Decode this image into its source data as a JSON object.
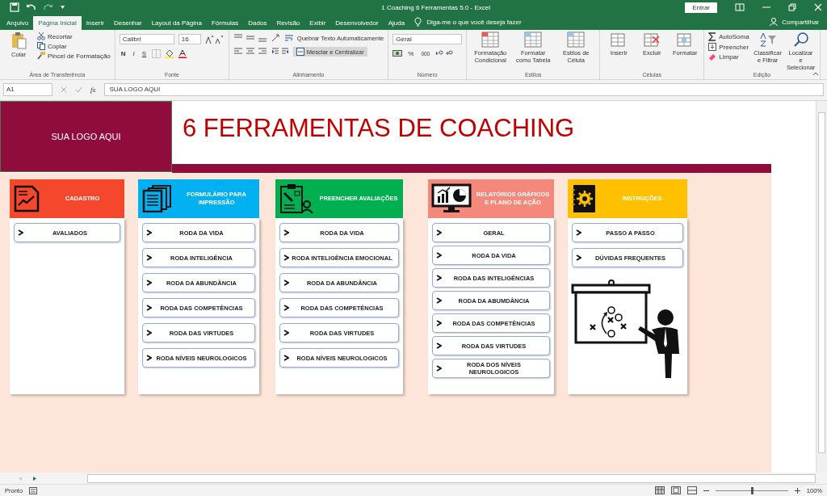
{
  "window": {
    "title": "1 Coaching 6 Ferramentas 5.0  -  Excel",
    "sign_in": "Entrar"
  },
  "ribbon_tabs": [
    {
      "label": "Arquivo",
      "selected": false
    },
    {
      "label": "Página Inicial",
      "selected": true
    },
    {
      "label": "Inserir",
      "selected": false
    },
    {
      "label": "Desenhar",
      "selected": false
    },
    {
      "label": "Layout da Página",
      "selected": false
    },
    {
      "label": "Fórmulas",
      "selected": false
    },
    {
      "label": "Dados",
      "selected": false
    },
    {
      "label": "Revisão",
      "selected": false
    },
    {
      "label": "Exibir",
      "selected": false
    },
    {
      "label": "Desenvolvedor",
      "selected": false
    },
    {
      "label": "Ajuda",
      "selected": false
    }
  ],
  "tell_me": "Diga-me o que você deseja fazer",
  "share": "Compartilhar",
  "clipboard": {
    "paste": "Colar",
    "cut": "Recortar",
    "copy": "Copiar",
    "format_painter": "Pincel de Formatação",
    "label": "Área de Transferência"
  },
  "font": {
    "name": "Calibri",
    "size": "16",
    "bold": "N",
    "italic": "I",
    "underline": "S",
    "label": "Fonte"
  },
  "alignment": {
    "wrap": "Quebrar Texto Automaticamente",
    "merge": "Mesclar e Centralizar",
    "label": "Alinhamento"
  },
  "number": {
    "format": "Geral",
    "percent": "%",
    "thousands": "000",
    "label": "Número"
  },
  "styles": {
    "items": [
      "Formatação Condicional",
      "Formatar como Tabela",
      "Estilos de Célula"
    ],
    "label": "Estilos"
  },
  "cells": {
    "items": [
      "Inserir",
      "Excluir",
      "Formatar"
    ],
    "label": "Células"
  },
  "editing": {
    "autosum": "AutoSoma",
    "fill": "Preencher",
    "clear": "Limpar",
    "sort": "Classificar e Filtrar",
    "find": "Localizar e Selecionar",
    "label": "Edição"
  },
  "formula_bar": {
    "name_box": "A1",
    "fx": "fx",
    "content": "SUA LOGO AQUI"
  },
  "sheet": {
    "logo": "SUA LOGO AQUI",
    "title": "6 FERRAMENTAS DE COACHING",
    "panels": [
      {
        "kind": "register",
        "title": "CADASTRO",
        "color": "#f4472c",
        "items": [
          "AVALIADOS"
        ]
      },
      {
        "kind": "print",
        "title": "FORMULÁRIO PARA IMPRESSÃO",
        "color": "#00b0f0",
        "items": [
          "RODA DA VIDA",
          "RODA INTELIGÊNCIA",
          "RODA DA ABUNDÂNCIA",
          "RODA DAS COMPETÊNCIAS",
          "RODA DAS VIRTUDES",
          "RODA NÍVEIS NEUROLOGICOS"
        ]
      },
      {
        "kind": "fill",
        "title": "PREENCHER AVALIAÇÕES",
        "color": "#00b050",
        "items": [
          "RODA DA VIDA",
          "RODA INTELIGÊNCIA EMOCIONAL",
          "RODA DA ABUNDÂNCIA",
          "RODA DAS COMPETÊNCIAS",
          "RODA DAS VIRTUDES",
          "RODA NÍVEIS NEUROLOGICOS"
        ]
      },
      {
        "kind": "reports",
        "title": "RELATÓRIOS  GRÁFICOS E PLANO DE AÇÃO",
        "color": "#f4897b",
        "items": [
          "GERAL",
          "RODA DA VIDA",
          "RODA DAS INTELIGÊNCIAS",
          "RODA DA ABUMDÂNCIA",
          "RODA DAS COMPETÊNCIAS",
          "RODA DAS VIRTUDES",
          "RODA DOS NÍVEIS NEUROLOGICOS"
        ]
      },
      {
        "kind": "instructions",
        "title": "INSTRUÇÕES",
        "color": "#ffc000",
        "items": [
          "PASSO A PASSO",
          "DÚVIDAS FREQUENTES"
        ]
      }
    ]
  },
  "status": {
    "text": "Pronto",
    "zoom": {
      "level": 0.5,
      "reading": "100%"
    }
  }
}
